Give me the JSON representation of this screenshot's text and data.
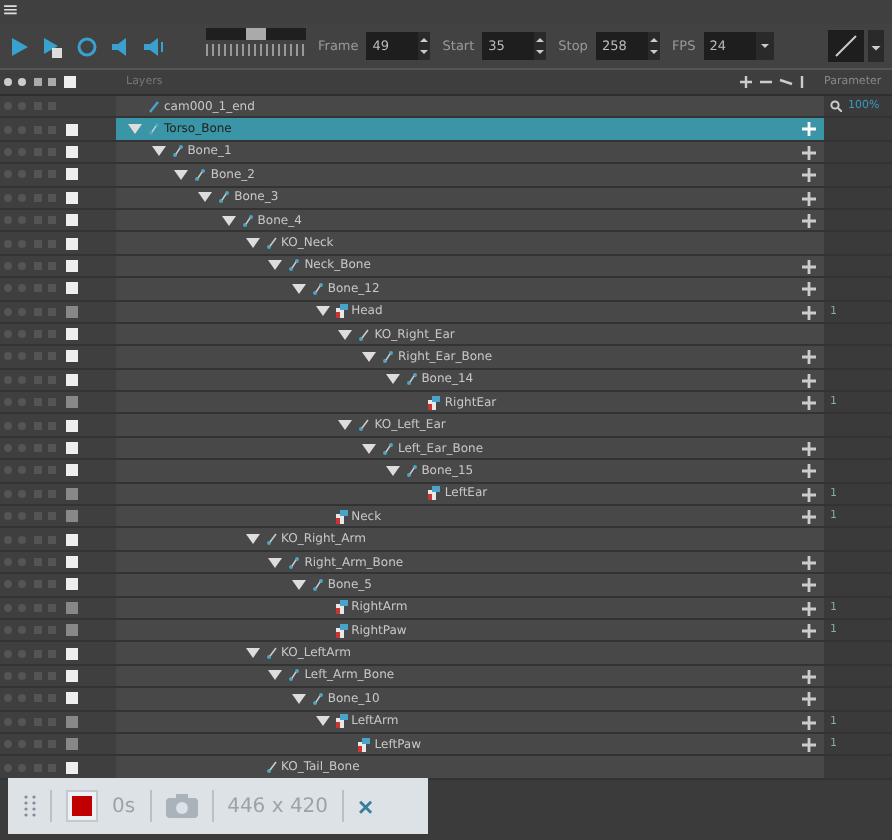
{
  "menu": {
    "icon": "≡"
  },
  "toolbar": {
    "speed": {
      "level": 0.5
    },
    "fields": [
      {
        "label": "Frame",
        "value": "49",
        "kind": "spin"
      },
      {
        "label": "Start",
        "value": "35",
        "kind": "spin"
      },
      {
        "label": "Stop",
        "value": "258",
        "kind": "spin"
      },
      {
        "label": "FPS",
        "value": "24",
        "kind": "dropdown"
      }
    ]
  },
  "header": {
    "title": "Layers",
    "parameters": "Parameter",
    "zoom": "100%"
  },
  "layers": [
    {
      "name": "cam000_1_end",
      "kind": "camera",
      "selected": false
    },
    {
      "name": "Torso_Bone",
      "kind": "bone",
      "checked": true,
      "selected": true,
      "children": [
        {
          "name": "Bone_1",
          "kind": "bone",
          "checked": true,
          "selected": false,
          "children": [
            {
              "name": "Bone_2",
              "kind": "bone",
              "checked": true,
              "selected": false,
              "children": [
                {
                  "name": "Bone_3",
                  "kind": "bone",
                  "checked": true,
                  "selected": false,
                  "children": [
                    {
                      "name": "Bone_4",
                      "kind": "bone",
                      "checked": true,
                      "selected": false,
                      "children": [
                        {
                          "name": "KO_Neck",
                          "kind": "cutter",
                          "checked": true,
                          "selected": false,
                          "children": [
                            {
                              "name": "Neck_Bone",
                              "kind": "bone",
                              "checked": true,
                              "selected": false,
                              "children": [
                                {
                                  "name": "Bone_12",
                                  "kind": "bone",
                                  "checked": true,
                                  "selected": false,
                                  "children": [
                                    {
                                      "name": "Head",
                                      "kind": "drawing",
                                      "count": "1",
                                      "checked": false,
                                      "selected": false,
                                      "children": [
                                        {
                                          "name": "KO_Right_Ear",
                                          "kind": "cutter",
                                          "checked": true,
                                          "selected": false,
                                          "children": [
                                            {
                                              "name": "Right_Ear_Bone",
                                              "kind": "bone",
                                              "checked": true,
                                              "selected": false,
                                              "children": [
                                                {
                                                  "name": "Bone_14",
                                                  "kind": "bone",
                                                  "checked": true,
                                                  "selected": false,
                                                  "children": [
                                                    {
                                                      "name": "RightEar",
                                                      "kind": "drawing",
                                                      "count": "1",
                                                      "checked": false,
                                                      "selected": false
                                                    }
                                                  ]
                                                }
                                              ]
                                            }
                                          ]
                                        },
                                        {
                                          "name": "KO_Left_Ear",
                                          "kind": "cutter",
                                          "checked": true,
                                          "selected": false,
                                          "children": [
                                            {
                                              "name": "Left_Ear_Bone",
                                              "kind": "bone",
                                              "checked": true,
                                              "selected": false,
                                              "children": [
                                                {
                                                  "name": "Bone_15",
                                                  "kind": "bone",
                                                  "checked": true,
                                                  "selected": false,
                                                  "children": [
                                                    {
                                                      "name": "LeftEar",
                                                      "kind": "drawing",
                                                      "count": "1",
                                                      "checked": false,
                                                      "selected": false
                                                    }
                                                  ]
                                                }
                                              ]
                                            }
                                          ]
                                        }
                                      ]
                                    },
                                    {
                                      "name": "Neck",
                                      "kind": "drawing",
                                      "count": "1",
                                      "checked": false,
                                      "selected": false
                                    }
                                  ]
                                }
                              ]
                            }
                          ]
                        },
                        {
                          "name": "KO_Right_Arm",
                          "kind": "cutter",
                          "checked": true,
                          "selected": false,
                          "children": [
                            {
                              "name": "Right_Arm_Bone",
                              "kind": "bone",
                              "checked": true,
                              "selected": false,
                              "children": [
                                {
                                  "name": "Bone_5",
                                  "kind": "bone",
                                  "checked": true,
                                  "selected": false,
                                  "children": [
                                    {
                                      "name": "RightArm",
                                      "kind": "drawing",
                                      "count": "1",
                                      "checked": false,
                                      "selected": false
                                    },
                                    {
                                      "name": "RightPaw",
                                      "kind": "drawing",
                                      "count": "1",
                                      "checked": false,
                                      "selected": false
                                    }
                                  ]
                                }
                              ]
                            }
                          ]
                        },
                        {
                          "name": "KO_LeftArm",
                          "kind": "cutter",
                          "checked": true,
                          "selected": false,
                          "children": [
                            {
                              "name": "Left_Arm_Bone",
                              "kind": "bone",
                              "checked": true,
                              "selected": false,
                              "children": [
                                {
                                  "name": "Bone_10",
                                  "kind": "bone",
                                  "checked": true,
                                  "selected": false,
                                  "children": [
                                    {
                                      "name": "LeftArm",
                                      "kind": "drawing",
                                      "count": "1",
                                      "checked": false,
                                      "selected": false,
                                      "children": [
                                        {
                                          "name": "LeftPaw",
                                          "kind": "drawing",
                                          "count": "1",
                                          "checked": false,
                                          "selected": false
                                        }
                                      ]
                                    }
                                  ]
                                }
                              ]
                            }
                          ]
                        },
                        {
                          "name": "KO_Tail_Bone",
                          "kind": "cutter",
                          "checked": true,
                          "selected": false
                        }
                      ]
                    }
                  ]
                }
              ]
            }
          ]
        }
      ]
    }
  ],
  "recorder": {
    "time": "0s",
    "size": "446 x 420",
    "close": "×"
  }
}
